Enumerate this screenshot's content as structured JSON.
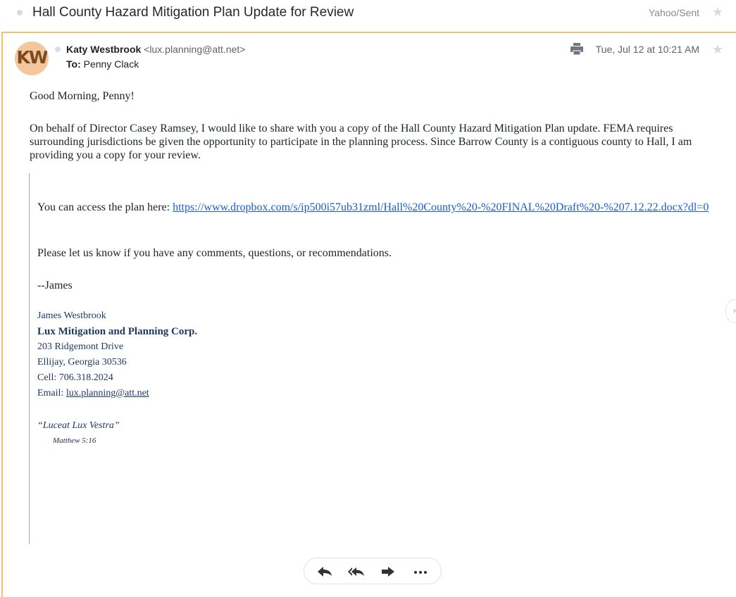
{
  "subject": {
    "title": "Hall County Hazard Mitigation Plan Update for Review",
    "folder": "Yahoo/Sent"
  },
  "header": {
    "avatar_initials": "KW",
    "sender_name": "Katy Westbrook",
    "sender_email": "<lux.planning@att.net>",
    "to_label": "To:",
    "to_name": "Penny Clack",
    "date": "Tue, Jul 12 at 10:21 AM"
  },
  "body": {
    "greeting": "Good Morning, Penny!",
    "paragraph": "On behalf of Director Casey Ramsey, I would like to share with you a copy of the Hall County Hazard Mitigation Plan update. FEMA requires surrounding jurisdictions be given the opportunity to participate in the planning process. Since Barrow County is a contiguous county to Hall, I am providing you a copy for your review."
  },
  "quoted": {
    "access_prefix": "You can access the plan here: ",
    "plan_link": "https://www.dropbox.com/s/ip500i57ub31zml/Hall%20County%20-%20FINAL%20Draft%20-%207.12.22.docx?dl=0",
    "request": "Please let us know if you have any comments, questions, or recommendations.",
    "signoff": "--James"
  },
  "signature": {
    "name": "James Westbrook",
    "company": "Lux Mitigation and Planning Corp.",
    "address1": "203 Ridgemont Drive",
    "address2": "Ellijay, Georgia 30536",
    "cell": "Cell: 706.318.2024",
    "email_label": "Email: ",
    "email": "lux.planning@att.net",
    "motto": "“Luceat Lux Vestra”",
    "verse": "Matthew 5:16"
  },
  "icons": {
    "print": "print-icon",
    "star": "star-icon",
    "reply": "reply-icon",
    "reply_all": "reply-all-icon",
    "forward": "forward-icon",
    "more": "more-icon",
    "next": "chevron-right-icon"
  },
  "colors": {
    "card_border": "#f0c36a",
    "link": "#1a5bd6",
    "signature": "#1f3864"
  }
}
